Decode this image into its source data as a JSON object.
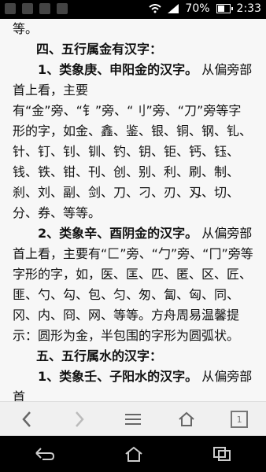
{
  "status_bar": {
    "battery_percent": "70%",
    "time": "2:33",
    "battery_level": 0.7
  },
  "article": {
    "lines": [
      "等。",
      "四、五行属金有汉字：",
      "1、类象庚、申阳金的汉字。从偏旁部首上看，主要有“金”旁、“钅”旁、“刂”旁、“刀”旁等字形的字，如金、鑫、鉴、银、铜、钢、钆、针、钉、钊、钏、钓、钥、钜、钙、钰、钱、铁、钳、刊、创、别、利、刷、制、刹、刘、副、剑、刀、刁、刃、刄、切、分、券、等等。",
      "2、类象辛、酉阴金的汉字。从偏旁部首上看，主要有“匚”旁、“勹”旁、“冂”旁等字形的字，如，医、匡、匹、匿、区、匠、匪、勺、勾、包、匀、匆、匐、匈、同、冈、内、冏、网、等等。方舟周易温馨提示：圆形为金，半包围的字形为圆弧状。",
      "五、五行属水的汉字：",
      "1、类象壬、子阳水的汉字。从偏旁部首"
    ],
    "bold_prefix_1": "1、类象庚、申阳金的汉字。",
    "bold_prefix_2": "2、类象辛、酉阴金的汉字。",
    "bold_prefix_3": "1、类象壬、子阳水的汉字。"
  },
  "browser_toolbar": {
    "tab_count": "1"
  }
}
